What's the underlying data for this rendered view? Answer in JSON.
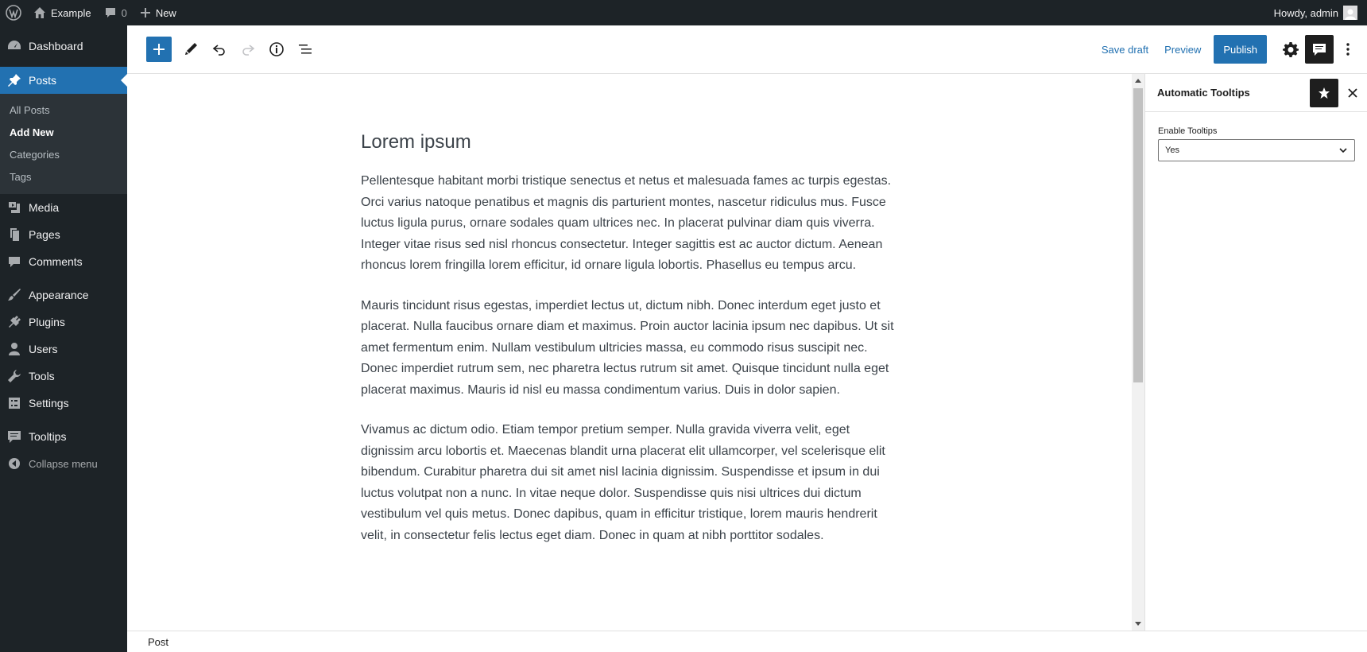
{
  "adminbar": {
    "site_name": "Example",
    "comments_count": "0",
    "new_label": "New",
    "greeting": "Howdy, admin"
  },
  "menu": {
    "dashboard": "Dashboard",
    "posts": "Posts",
    "posts_sub": [
      "All Posts",
      "Add New",
      "Categories",
      "Tags"
    ],
    "media": "Media",
    "pages": "Pages",
    "comments": "Comments",
    "appearance": "Appearance",
    "plugins": "Plugins",
    "users": "Users",
    "tools": "Tools",
    "settings": "Settings",
    "tooltips": "Tooltips",
    "collapse": "Collapse menu"
  },
  "toolbar": {
    "save_draft": "Save draft",
    "preview": "Preview",
    "publish": "Publish"
  },
  "post": {
    "title": "Lorem ipsum",
    "paragraphs": [
      "Pellentesque habitant morbi tristique senectus et netus et malesuada fames ac turpis egestas. Orci varius natoque penatibus et magnis dis parturient montes, nascetur ridiculus mus. Fusce luctus ligula purus, ornare sodales quam ultrices nec. In placerat pulvinar diam quis viverra. Integer vitae risus sed nisl rhoncus consectetur. Integer sagittis est ac auctor dictum. Aenean rhoncus lorem fringilla lorem efficitur, id ornare ligula lobortis. Phasellus eu tempus arcu.",
      "Mauris tincidunt risus egestas, imperdiet lectus ut, dictum nibh. Donec interdum eget justo et placerat. Nulla faucibus ornare diam et maximus. Proin auctor lacinia ipsum nec dapibus. Ut sit amet fermentum enim. Nullam vestibulum ultricies massa, eu commodo risus suscipit nec. Donec imperdiet rutrum sem, nec pharetra lectus rutrum sit amet. Quisque tincidunt nulla eget placerat maximus. Mauris id nisl eu massa condimentum varius. Duis in dolor sapien.",
      "Vivamus ac dictum odio. Etiam tempor pretium semper. Nulla gravida viverra velit, eget dignissim arcu lobortis et. Maecenas blandit urna placerat elit ullamcorper, vel scelerisque elit bibendum. Curabitur pharetra dui sit amet nisl lacinia dignissim. Suspendisse et ipsum in dui luctus volutpat non a nunc. In vitae neque dolor. Suspendisse quis nisi ultrices dui dictum vestibulum vel quis metus. Donec dapibus, quam in efficitur tristique, lorem mauris hendrerit velit, in consectetur felis lectus eget diam. Donec in quam at nibh porttitor sodales."
    ]
  },
  "sidebar": {
    "title": "Automatic Tooltips",
    "field_label": "Enable Tooltips",
    "field_value": "Yes"
  },
  "footer": {
    "breadcrumb": "Post"
  },
  "colors": {
    "admin_dark": "#1d2327",
    "accent": "#2271b1"
  }
}
